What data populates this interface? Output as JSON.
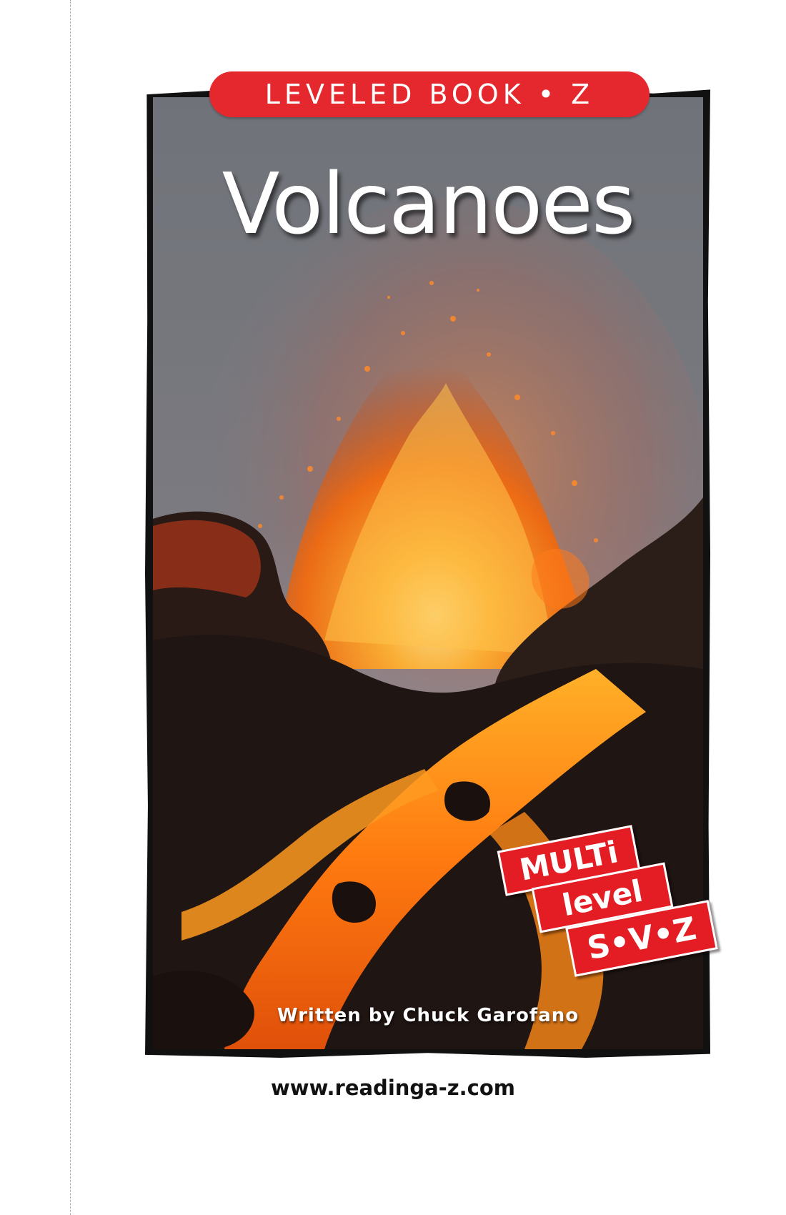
{
  "cover": {
    "level_banner": "LEVELED BOOK • Z",
    "title": "Volcanoes",
    "badge": {
      "line1": "MULTi",
      "line2": "level",
      "line3": "S•V•Z"
    },
    "author": "Written by Chuck Garofano",
    "website": "www.readinga-z.com"
  },
  "colors": {
    "banner_red": "#e5282d",
    "badge_red": "#e41c23",
    "frame_black": "#111111",
    "lava_orange": "#ff7a10"
  }
}
